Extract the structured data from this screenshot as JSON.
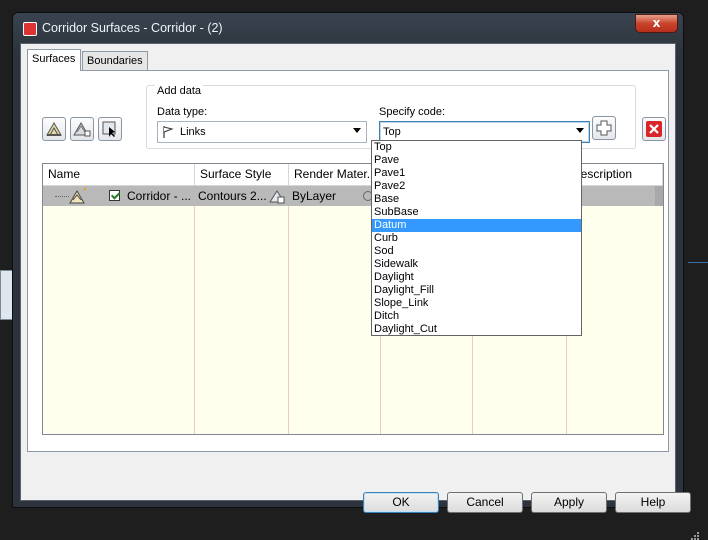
{
  "window": {
    "title": "Corridor Surfaces - Corridor - (2)",
    "close_glyph": "x"
  },
  "tabs": [
    {
      "label": "Surfaces",
      "active": true
    },
    {
      "label": "Boundaries",
      "active": false
    }
  ],
  "add_data": {
    "group_label": "Add data",
    "data_type_label": "Data type:",
    "data_type_value": "Links",
    "specify_code_label": "Specify code:",
    "specify_code_value": "Top"
  },
  "grid": {
    "columns": [
      "Name",
      "Surface Style",
      "Render Mater...",
      "Description"
    ],
    "rows": [
      {
        "name": "Corridor - ...",
        "checked": true,
        "surface_style": "Contours 2...",
        "render_material": "ByLayer"
      }
    ]
  },
  "code_options": [
    "Top",
    "Pave",
    "Pave1",
    "Pave2",
    "Base",
    "SubBase",
    "Datum",
    "Curb",
    "Sod",
    "Sidewalk",
    "Daylight",
    "Daylight_Fill",
    "Slope_Link",
    "Ditch",
    "Daylight_Cut"
  ],
  "selected_code_option": "Datum",
  "buttons": {
    "ok": "OK",
    "cancel": "Cancel",
    "apply": "Apply",
    "help": "Help"
  },
  "colors": {
    "grid_background": "#ffffee",
    "selection": "#3399ff",
    "remove_icon": "#d9262a",
    "row_highlight": "#b9b9b9"
  }
}
